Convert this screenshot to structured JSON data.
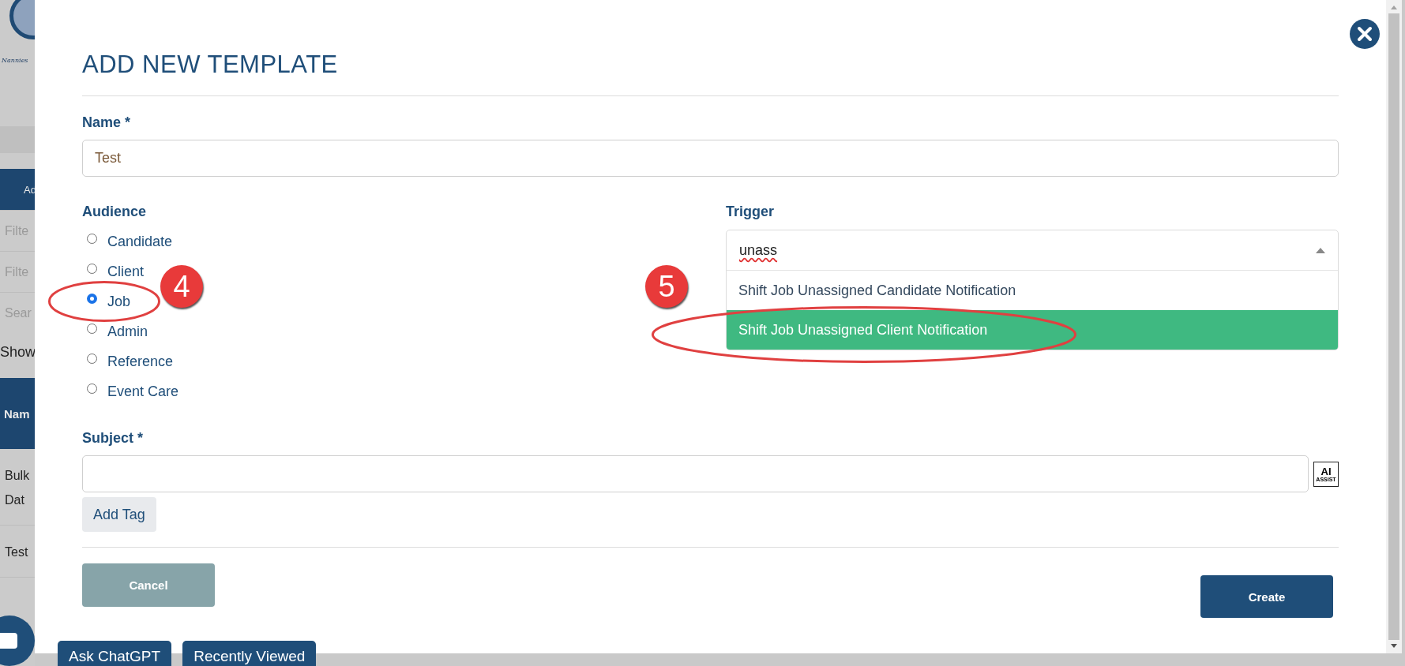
{
  "background_page": {
    "logo_text": "Nannies",
    "header_button": "Ad",
    "filters": [
      "Filte",
      "Filte",
      "Sear"
    ],
    "show_label": "Show",
    "table_header": "Nam",
    "rows": [
      [
        "Bulk",
        "Dat"
      ],
      [
        "Test"
      ]
    ]
  },
  "modal": {
    "title": "ADD NEW TEMPLATE",
    "name_field": {
      "label": "Name *",
      "value": "Test"
    },
    "audience": {
      "label": "Audience",
      "options": [
        {
          "label": "Candidate",
          "selected": false
        },
        {
          "label": "Client",
          "selected": false
        },
        {
          "label": "Job",
          "selected": true
        },
        {
          "label": "Admin",
          "selected": false
        },
        {
          "label": "Reference",
          "selected": false
        },
        {
          "label": "Event Care",
          "selected": false
        }
      ]
    },
    "trigger": {
      "label": "Trigger",
      "value": "unass",
      "expanded": true,
      "options": [
        {
          "label": "Shift Job Unassigned Candidate Notification",
          "selected": false
        },
        {
          "label": "Shift Job Unassigned Client Notification",
          "selected": true
        }
      ]
    },
    "subject_field": {
      "label": "Subject *"
    },
    "ai_assist": {
      "big": "AI",
      "small": "ASSIST"
    },
    "add_tag_button": "Add Tag",
    "cancel_button": "Cancel",
    "create_button": "Create"
  },
  "bottom_buttons": [
    "Ask ChatGPT",
    "Recently Viewed"
  ],
  "annotations": [
    {
      "number": "4"
    },
    {
      "number": "5"
    }
  ]
}
